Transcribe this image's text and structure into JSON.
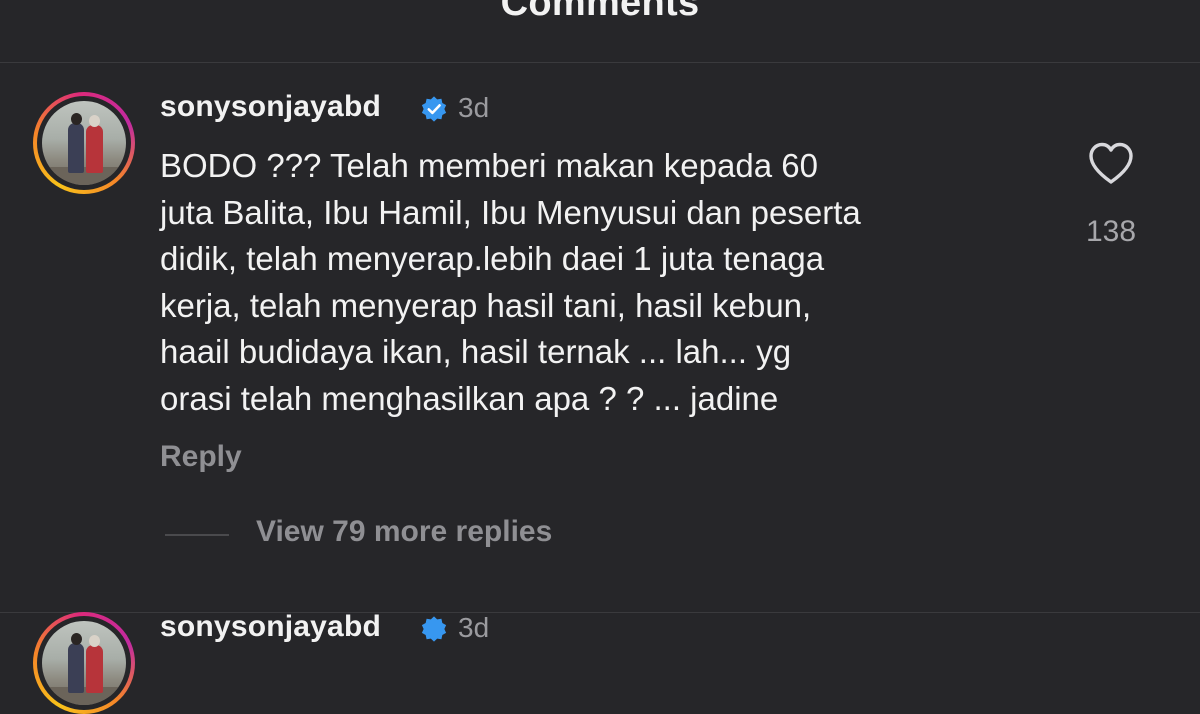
{
  "header": {
    "title": "Comments"
  },
  "comment": {
    "username": "sonysonjayabd",
    "verified_icon": "verified-badge-icon",
    "time": "3d",
    "text": "BODO ??? Telah memberi makan kepada 60\njuta Balita, Ibu Hamil, Ibu Menyusui dan peserta\ndidik, telah menyerap.lebih daei 1 juta tenaga\nkerja, telah menyerap hasil tani, hasil kebun,\nhaail budidaya ikan, hasil ternak ... lah... yg\norasi telah menghasilkan apa ? ? ... jadine",
    "like_icon": "heart-icon",
    "like_count": "138",
    "reply_label": "Reply",
    "view_replies_label": "View 79 more replies"
  },
  "next_comment": {
    "username": "sonysonjayabd",
    "time": "3d"
  },
  "colors": {
    "background": "#262629",
    "text_primary": "#f2f2f2",
    "text_secondary": "#8f8f93",
    "verified_blue": "#3797f0",
    "story_ring_start": "#f9c21a",
    "story_ring_end": "#dd2a7b"
  }
}
